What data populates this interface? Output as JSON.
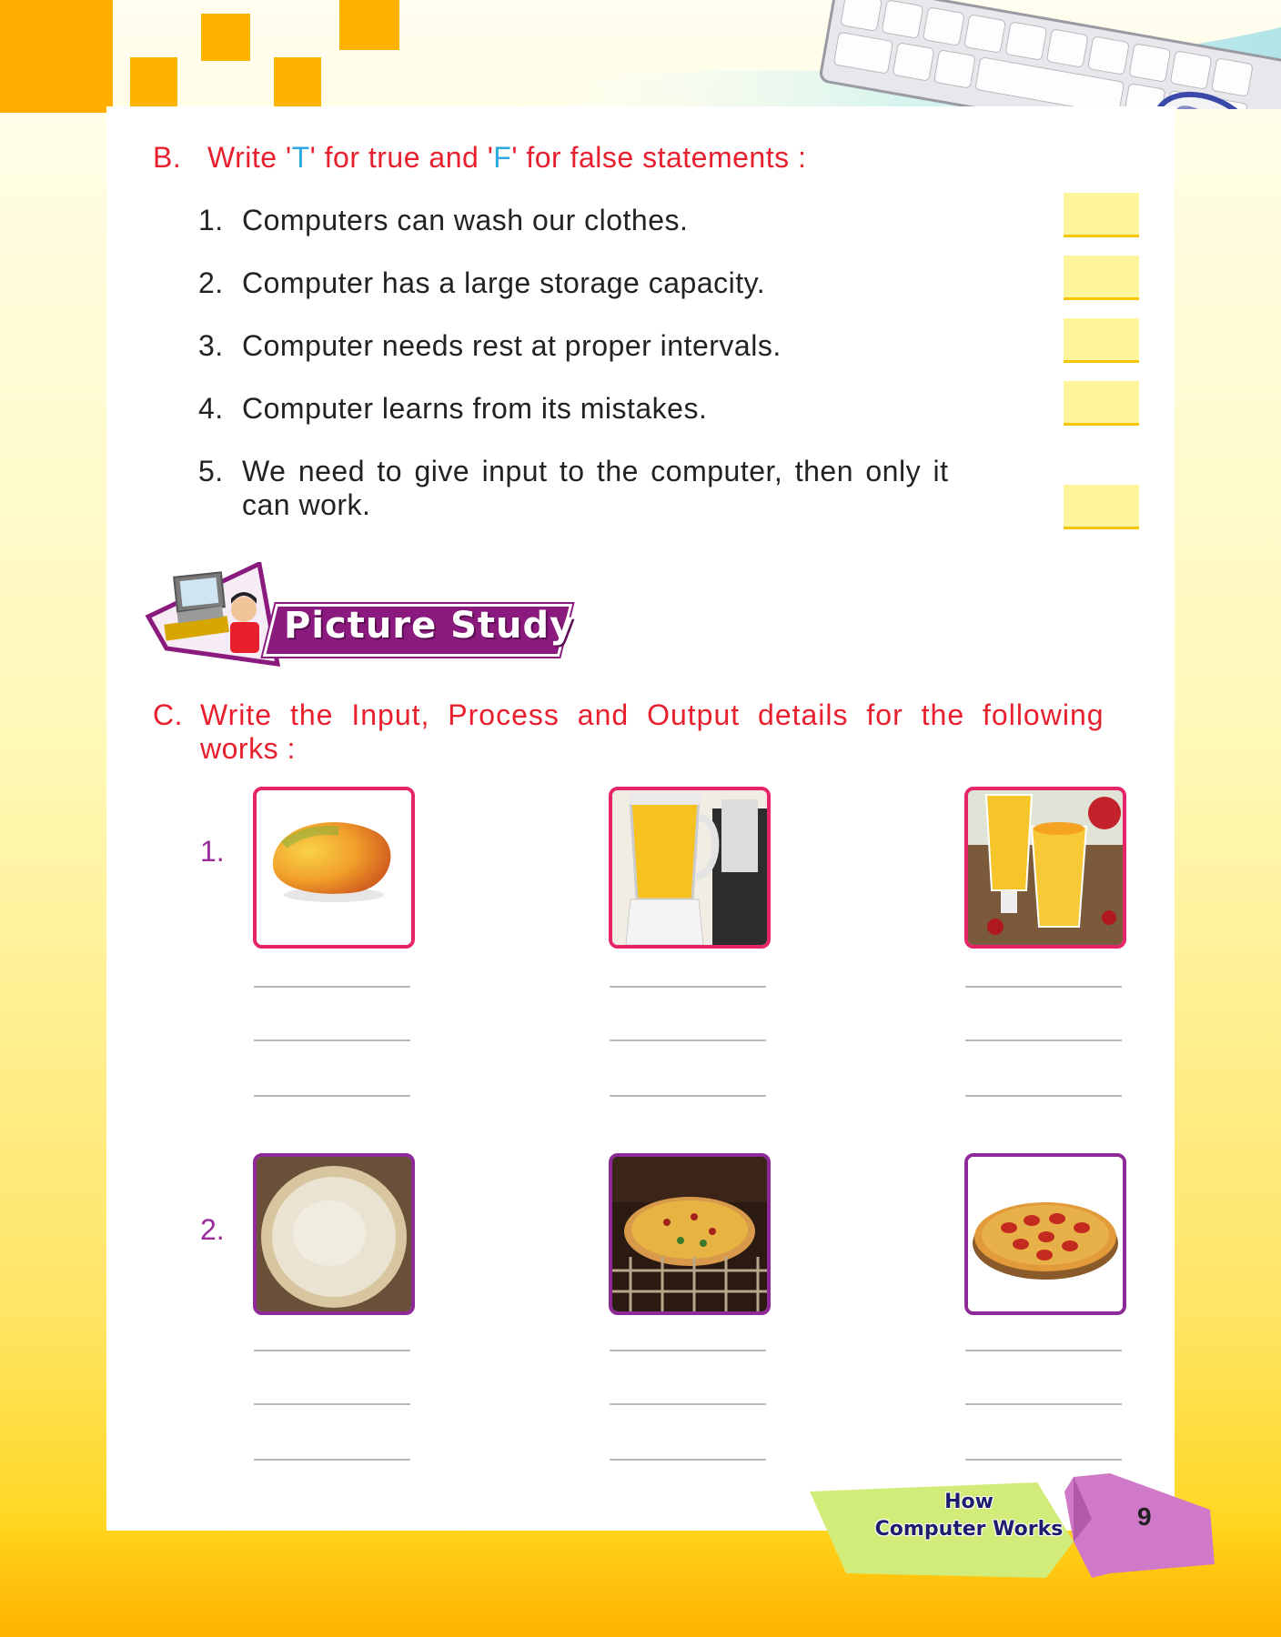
{
  "section_b": {
    "letter": "B.",
    "heading_pre": "Write '",
    "heading_t": "T",
    "heading_mid": "' for true and '",
    "heading_f": "F",
    "heading_post": "' for false statements :",
    "statements": [
      {
        "num": "1.",
        "text": "Computers can wash our clothes."
      },
      {
        "num": "2.",
        "text": "Computer has a large storage capacity."
      },
      {
        "num": "3.",
        "text": "Computer needs rest at proper intervals."
      },
      {
        "num": "4.",
        "text": "Computer learns from its mistakes."
      },
      {
        "num": "5.",
        "text_line1": "We need to give input to the computer, then only it",
        "text_line2": "can work."
      }
    ]
  },
  "picture_study": {
    "label": "Picture Study"
  },
  "section_c": {
    "letter": "C.",
    "heading_line1": "Write the Input, Process and Output details for the following",
    "heading_line2": "works :",
    "rows": [
      {
        "num": "1.",
        "images": [
          "mango",
          "juice-blender",
          "mango-shake-glasses"
        ]
      },
      {
        "num": "2.",
        "images": [
          "pizza-dough-base",
          "pizza-in-oven",
          "pepperoni-pizza"
        ]
      }
    ]
  },
  "footer": {
    "chapter_line1": "How",
    "chapter_line2": "Computer Works",
    "page_number": "9"
  },
  "colors": {
    "heading_red": "#e8202e",
    "highlight_blue": "#2ba8e0",
    "answer_box": "#fff59a",
    "banner_purple": "#8b1a7e",
    "frame_pink": "#e6246a",
    "frame_purple": "#8e2a98"
  }
}
